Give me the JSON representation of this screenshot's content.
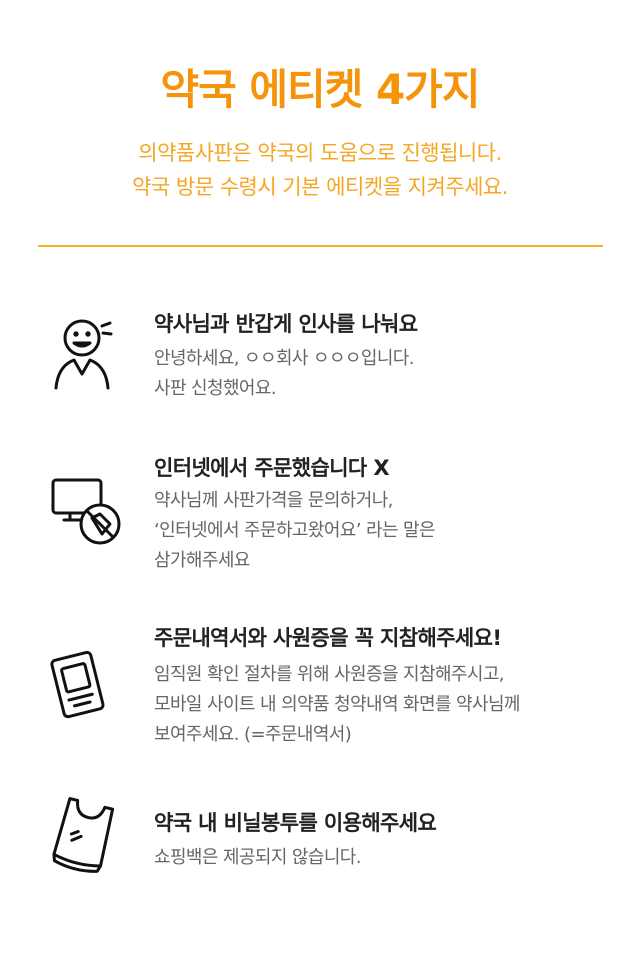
{
  "header": {
    "title": "약국 에티켓 4가지",
    "subtitle_lines": [
      "의약품사판은 약국의 도움으로 진행됩니다.",
      "약국 방문 수령시 기본 에티켓을 지켜주세요."
    ]
  },
  "colors": {
    "accent": "#f5930a",
    "subtitle": "#f5a623",
    "divider": "#f1b52a",
    "heading": "#222222",
    "body": "#666666"
  },
  "items": [
    {
      "icon": "greeting-person-icon",
      "heading": "약사님과 반갑게 인사를 나눠요",
      "lines": [
        "안녕하세요, ㅇㅇ회사 ㅇㅇㅇ입니다.",
        "사판 신청했어요."
      ]
    },
    {
      "icon": "no-computer-icon",
      "heading": "인터넷에서 주문했습니다 X",
      "lines": [
        "약사님께 사판가격을 문의하거나,",
        "‘인터넷에서 주문하고왔어요’ 라는 말은",
        "삼가해주세요"
      ]
    },
    {
      "icon": "id-card-icon",
      "heading": "주문내역서와 사원증을 꼭 지참해주세요!",
      "lines": [
        "임직원 확인 절차를 위해 사원증을 지참해주시고,",
        "모바일 사이트 내 의약품 청약내역 화면를 약사님께",
        "보여주세요. (=주문내역서)"
      ]
    },
    {
      "icon": "plastic-bag-icon",
      "heading": "약국 내 비닐봉투를 이용해주세요",
      "lines": [
        "쇼핑백은 제공되지 않습니다."
      ]
    }
  ]
}
